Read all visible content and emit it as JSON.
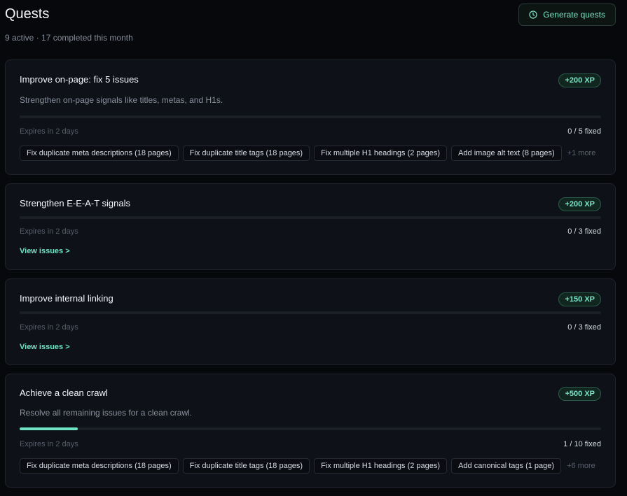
{
  "header": {
    "title": "Quests",
    "subtitle": "9 active · 17 completed this month",
    "generate_label": "Generate quests",
    "generate_icon": "clock-icon"
  },
  "colors": {
    "accent": "#6fe3c6",
    "card_bg": "#0e1118",
    "page_bg": "#07080c"
  },
  "quests": [
    {
      "title": "Improve on-page: fix 5 issues",
      "xp": "+200 XP",
      "description": "Strengthen on-page signals like titles, metas, and H1s.",
      "progress": 0,
      "expires": "Expires in 2 days",
      "fixed": "0 / 5 fixed",
      "chips": [
        "Fix duplicate meta descriptions (18 pages)",
        "Fix duplicate title tags (18 pages)",
        "Fix multiple H1 headings (2 pages)",
        "Add image alt text (8 pages)"
      ],
      "more": "+1 more"
    },
    {
      "title": "Strengthen E-E-A-T signals",
      "xp": "+200 XP",
      "progress": 0,
      "expires": "Expires in 2 days",
      "fixed": "0 / 3 fixed",
      "view_label": "View issues >"
    },
    {
      "title": "Improve internal linking",
      "xp": "+150 XP",
      "progress": 0,
      "expires": "Expires in 2 days",
      "fixed": "0 / 3 fixed",
      "view_label": "View issues >"
    },
    {
      "title": "Achieve a clean crawl",
      "xp": "+500 XP",
      "description": "Resolve all remaining issues for a clean crawl.",
      "progress": 0.1,
      "expires": "Expires in 2 days",
      "fixed": "1 / 10 fixed",
      "chips": [
        "Fix duplicate meta descriptions (18 pages)",
        "Fix duplicate title tags (18 pages)",
        "Fix multiple H1 headings (2 pages)",
        "Add canonical tags (1 page)"
      ],
      "more": "+6 more"
    }
  ]
}
